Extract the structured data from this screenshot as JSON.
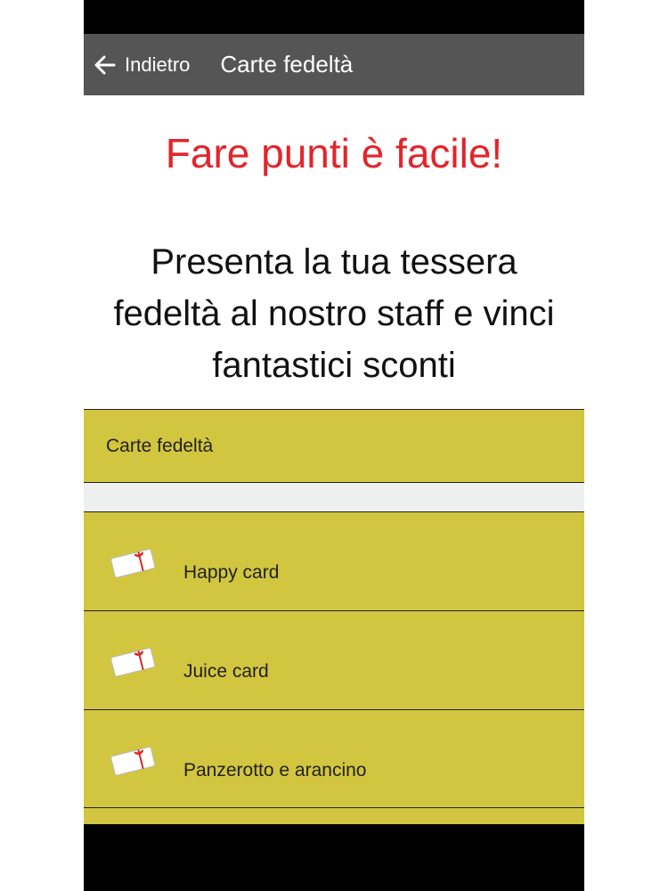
{
  "app_bar": {
    "back_label": "Indietro",
    "title": "Carte fedeltà",
    "background": "#555555"
  },
  "hero": {
    "headline": "Fare punti è facile!",
    "headline_color": "#e2252b",
    "body": "Presenta la tua tessera fedeltà al nostro staff e vinci fantastici sconti"
  },
  "section": {
    "title": "Carte fedeltà",
    "background": "#d2c640"
  },
  "cards": [
    {
      "label": "Happy card",
      "icon": "gift-card-icon"
    },
    {
      "label": "Juice card",
      "icon": "gift-card-icon"
    },
    {
      "label": "Panzerotto e arancino",
      "icon": "gift-card-icon"
    }
  ]
}
